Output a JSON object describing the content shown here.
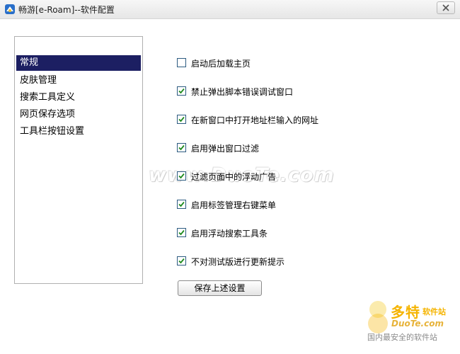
{
  "window": {
    "title": "畅游[e-Roam]--软件配置"
  },
  "sidebar": {
    "items": [
      {
        "label": "常规",
        "selected": true
      },
      {
        "label": "皮肤管理",
        "selected": false
      },
      {
        "label": "搜索工具定义",
        "selected": false
      },
      {
        "label": "网页保存选项",
        "selected": false
      },
      {
        "label": "工具栏按钮设置",
        "selected": false
      }
    ]
  },
  "options": [
    {
      "label": "启动后加载主页",
      "checked": false
    },
    {
      "label": "禁止弹出脚本错误调试窗口",
      "checked": true
    },
    {
      "label": "在新窗口中打开地址栏输入的网址",
      "checked": true
    },
    {
      "label": "启用弹出窗口过滤",
      "checked": true
    },
    {
      "label": "过滤页面中的浮动广告",
      "checked": true
    },
    {
      "label": "启用标签管理右键菜单",
      "checked": true
    },
    {
      "label": "启用浮动搜索工具条",
      "checked": true
    },
    {
      "label": "不对测试版进行更新提示",
      "checked": true
    }
  ],
  "actions": {
    "save_label": "保存上述设置"
  },
  "watermark": {
    "center_text": "www.DuoTe.com",
    "brand": "多特",
    "brand_sub": "软件站",
    "url": "DuoTe.com",
    "tagline": "国内最安全的软件站"
  },
  "colors": {
    "selection": "#1c1f62",
    "check": "#1e8a1e",
    "checkbox_border": "#2c5b80",
    "watermark_gold": "#f5b400"
  }
}
